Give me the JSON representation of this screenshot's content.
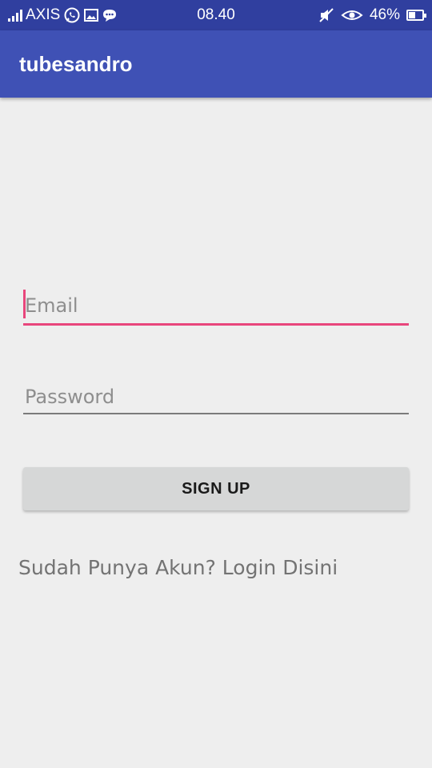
{
  "status_bar": {
    "carrier": "AXIS",
    "time": "08.40",
    "battery": "46%",
    "battery_level": 0.46,
    "icons": [
      "signal-icon",
      "whatsapp-icon",
      "image-icon",
      "message-icon",
      "mute-icon",
      "eye-icon",
      "battery-icon"
    ]
  },
  "app_bar": {
    "title": "tubesandro",
    "color": "#3f51b5"
  },
  "form": {
    "email_placeholder": "Email",
    "password_placeholder": "Password",
    "signup_label": "SIGN UP",
    "login_link": "Sudah Punya Akun? Login Disini",
    "accent_color": "#e8467c"
  }
}
